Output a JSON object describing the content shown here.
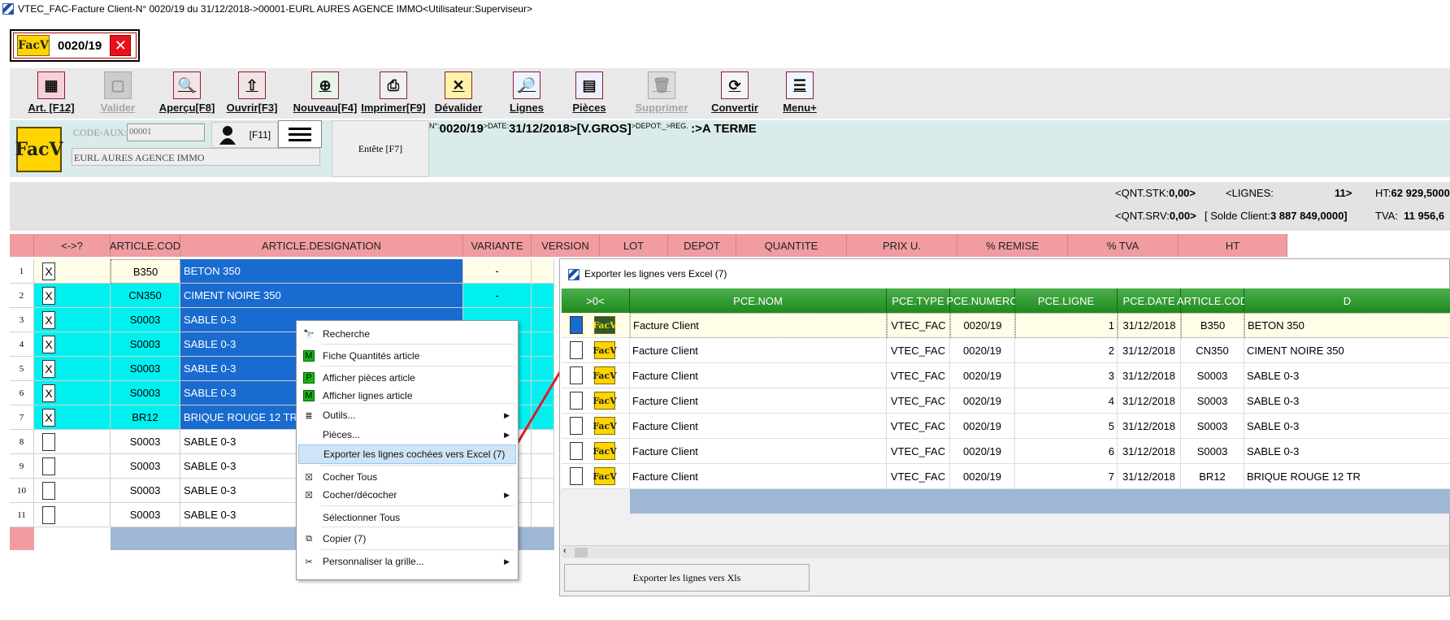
{
  "window": {
    "title": "VTEC_FAC-Facture Client-N° 0020/19 du 31/12/2018->00001-EURL AURES AGENCE IMMO<Utilisateur:Superviseur>"
  },
  "tab": {
    "badge": "FacV",
    "label": "0020/19",
    "close": "✕"
  },
  "toolbar": [
    {
      "label": "Art. [F12]",
      "icon": "▦"
    },
    {
      "label": "Valider",
      "icon": "▢"
    },
    {
      "label": "Aperçu[F8]",
      "icon": "🔍"
    },
    {
      "label": "Ouvrir[F3]",
      "icon": "⇧"
    },
    {
      "label": "Nouveau[F4]",
      "icon": "⊕"
    },
    {
      "label": "Imprimer[F9]",
      "icon": "⎙"
    },
    {
      "label": "Dévalider",
      "icon": "✕"
    },
    {
      "label": "Lignes",
      "icon": "🔎"
    },
    {
      "label": "Pièces",
      "icon": "▤"
    },
    {
      "label": "Supprimer",
      "icon": "🗑"
    },
    {
      "label": "Convertir",
      "icon": "⟳"
    },
    {
      "label": "Menu+",
      "icon": "☰"
    }
  ],
  "header": {
    "badge": "FacV",
    "code_aux_label": "CODE-AUX:",
    "code_aux_value": "00001",
    "client_name": "EURL AURES AGENCE IMMO",
    "f11": "[F11]",
    "entete": "Entête [F7]",
    "num_label": "N°:",
    "num": "0020/19",
    "date_label": ">DATE:",
    "date": "31/12/2018",
    "type": ">[V.GROS]",
    "depot_label": ">DEPOT:_>REG.",
    "reg": ":>A TERME"
  },
  "status": {
    "qnt_stk_label": "<QNT.STK:",
    "qnt_stk": "0,00>",
    "lignes_label": "<LIGNES:",
    "lignes": "11>",
    "ht_label": "HT:",
    "ht": "62 929,5000",
    "qnt_srv_label": "<QNT.SRV:",
    "qnt_srv": "0,00>",
    "solde_label": "[ Solde Client:",
    "solde": "3 887 849,0000]",
    "tva_label": "TVA:",
    "tva": "11 956,6"
  },
  "grid": {
    "headers": [
      "",
      "<->?",
      "ARTICLE.COD",
      "ARTICLE.DESIGNATION",
      "VARIANTE",
      "VERSION",
      "LOT",
      "DEPOT",
      "QUANTITE",
      "PRIX U.",
      "% REMISE",
      "% TVA",
      "HT"
    ],
    "rows": [
      {
        "n": "1",
        "chk": "X",
        "code": "B350",
        "desig": "BETON 350",
        "var": "-"
      },
      {
        "n": "2",
        "chk": "X",
        "code": "CN350",
        "desig": "CIMENT NOIRE 350",
        "var": "-"
      },
      {
        "n": "3",
        "chk": "X",
        "code": "S0003",
        "desig": "SABLE 0-3",
        "var": ""
      },
      {
        "n": "4",
        "chk": "X",
        "code": "S0003",
        "desig": "SABLE 0-3",
        "var": ""
      },
      {
        "n": "5",
        "chk": "X",
        "code": "S0003",
        "desig": "SABLE 0-3",
        "var": ""
      },
      {
        "n": "6",
        "chk": "X",
        "code": "S0003",
        "desig": "SABLE 0-3",
        "var": ""
      },
      {
        "n": "7",
        "chk": "X",
        "code": "BR12",
        "desig": "BRIQUE ROUGE 12 TR",
        "var": ""
      },
      {
        "n": "8",
        "chk": "",
        "code": "S0003",
        "desig": "SABLE 0-3",
        "var": ""
      },
      {
        "n": "9",
        "chk": "",
        "code": "S0003",
        "desig": "SABLE 0-3",
        "var": ""
      },
      {
        "n": "10",
        "chk": "",
        "code": "S0003",
        "desig": "SABLE 0-3",
        "var": ""
      },
      {
        "n": "11",
        "chk": "",
        "code": "S0003",
        "desig": "SABLE 0-3",
        "var": ""
      }
    ]
  },
  "context_menu": [
    {
      "label": "Recherche",
      "icon": "🔭"
    },
    {
      "label": "Fiche Quantités article",
      "icon": "M"
    },
    {
      "label": "Afficher pièces article",
      "icon": "P"
    },
    {
      "label": "Afficher lignes article",
      "icon": "M"
    },
    {
      "label": "Outils...",
      "icon": "≣"
    },
    {
      "label": "Pièces...",
      "icon": ""
    },
    {
      "label": "Exporter les lignes cochées vers Excel (7)",
      "icon": ""
    },
    {
      "label": "Cocher Tous",
      "icon": "☒"
    },
    {
      "label": "Cocher/décocher",
      "icon": "☒"
    },
    {
      "label": "Sélectionner Tous",
      "icon": ""
    },
    {
      "label": "Copier (7)",
      "icon": "⧉"
    },
    {
      "label": "Personnaliser la grille...",
      "icon": "✂"
    }
  ],
  "export_panel": {
    "title": "Exporter les lignes vers Excel (7)",
    "headers": [
      ">0<",
      "PCE.NOM",
      "PCE.TYPE",
      "PCE.NUMERO",
      "PCE.LIGNE",
      "PCE.DATE",
      "ARTICLE.COD",
      "D"
    ],
    "badge": "FacV",
    "rows": [
      {
        "nom": "Facture Client",
        "type": "VTEC_FAC",
        "num": "0020/19",
        "ligne": "1",
        "date": "31/12/2018",
        "code": "B350",
        "desig": "BETON 350"
      },
      {
        "nom": "Facture Client",
        "type": "VTEC_FAC",
        "num": "0020/19",
        "ligne": "2",
        "date": "31/12/2018",
        "code": "CN350",
        "desig": "CIMENT NOIRE 350"
      },
      {
        "nom": "Facture Client",
        "type": "VTEC_FAC",
        "num": "0020/19",
        "ligne": "3",
        "date": "31/12/2018",
        "code": "S0003",
        "desig": "SABLE 0-3"
      },
      {
        "nom": "Facture Client",
        "type": "VTEC_FAC",
        "num": "0020/19",
        "ligne": "4",
        "date": "31/12/2018",
        "code": "S0003",
        "desig": "SABLE 0-3"
      },
      {
        "nom": "Facture Client",
        "type": "VTEC_FAC",
        "num": "0020/19",
        "ligne": "5",
        "date": "31/12/2018",
        "code": "S0003",
        "desig": "SABLE 0-3"
      },
      {
        "nom": "Facture Client",
        "type": "VTEC_FAC",
        "num": "0020/19",
        "ligne": "6",
        "date": "31/12/2018",
        "code": "S0003",
        "desig": "SABLE 0-3"
      },
      {
        "nom": "Facture Client",
        "type": "VTEC_FAC",
        "num": "0020/19",
        "ligne": "7",
        "date": "31/12/2018",
        "code": "BR12",
        "desig": "BRIQUE ROUGE 12 TR"
      }
    ],
    "export_button": "Exporter les lignes  vers Xls"
  },
  "colors": {
    "selected_row": "#1a6bd0",
    "cyan": "#00f0f0",
    "header_pink": "#f09ca0",
    "green_header": "#2e9b2e"
  }
}
